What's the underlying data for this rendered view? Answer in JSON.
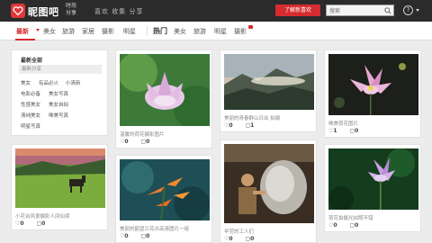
{
  "header": {
    "logo_text": "昵图吧",
    "logo_sub": "时尚 分享",
    "slogan": "喜欢 收集 分享",
    "cta_label": "了解新喜欢",
    "search_placeholder": "搜索",
    "help_label": "?"
  },
  "nav": {
    "left_items": [
      "最新",
      "美女",
      "旅游",
      "家居",
      "摄影",
      "明星"
    ],
    "hot_label": "热门",
    "right_items": [
      "美女",
      "旅游",
      "明星",
      "摄影"
    ]
  },
  "sidebar": {
    "title": "最新全部",
    "search_label": "最新分享",
    "links": [
      [
        "美女",
        "有品必火",
        "小清新"
      ],
      [
        "电影必备",
        "美女写真"
      ],
      [
        "性感美女",
        "美女自拍"
      ],
      [
        "清纯美女",
        "唯美写真"
      ],
      [
        "明星写真"
      ]
    ]
  },
  "cards": [
    {
      "caption": "温馨的荷花摄影图片",
      "likes": "0",
      "comments": "0"
    },
    {
      "caption": "美丽的青春群山日出 拍摄",
      "likes": "0",
      "comments": "1"
    },
    {
      "caption": "唯美荷花图片",
      "likes": "1",
      "comments": "0"
    },
    {
      "caption": "小花台风景摄影人间仙境",
      "likes": "0",
      "comments": "0"
    },
    {
      "caption": "美丽的鹤望兰花卉高清图片一组",
      "likes": "0",
      "comments": "0"
    },
    {
      "caption": "辛劳的工人们",
      "likes": "0",
      "comments": "0"
    },
    {
      "caption": "荷花拍摄光拍照不错",
      "likes": "0",
      "comments": "0"
    }
  ],
  "colors": {
    "accent": "#d62b2f",
    "header_bg": "#2b2b2b",
    "page_bg": "#ececec"
  }
}
